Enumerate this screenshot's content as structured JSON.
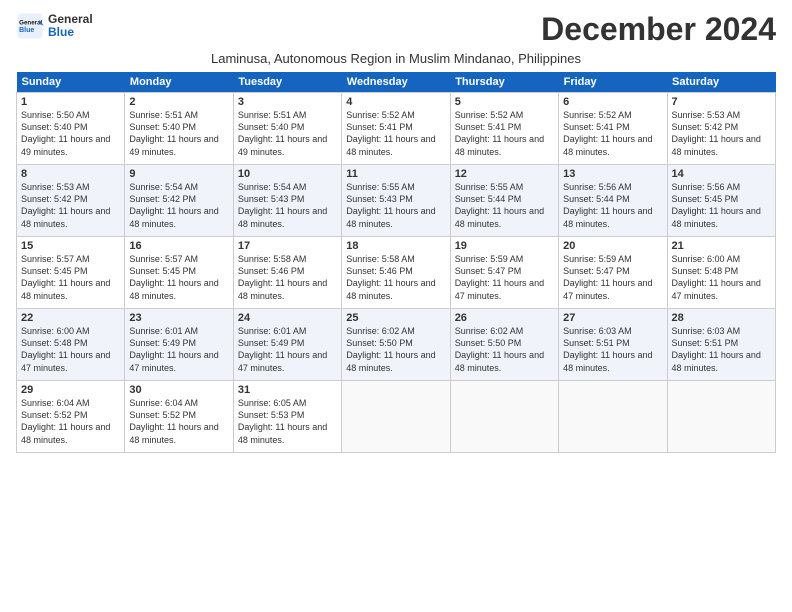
{
  "logo": {
    "line1": "General",
    "line2": "Blue"
  },
  "title": "December 2024",
  "subtitle": "Laminusa, Autonomous Region in Muslim Mindanao, Philippines",
  "days_header": [
    "Sunday",
    "Monday",
    "Tuesday",
    "Wednesday",
    "Thursday",
    "Friday",
    "Saturday"
  ],
  "weeks": [
    [
      {
        "day": "1",
        "sunrise": "5:50 AM",
        "sunset": "5:40 PM",
        "daylight": "11 hours and 49 minutes."
      },
      {
        "day": "2",
        "sunrise": "5:51 AM",
        "sunset": "5:40 PM",
        "daylight": "11 hours and 49 minutes."
      },
      {
        "day": "3",
        "sunrise": "5:51 AM",
        "sunset": "5:40 PM",
        "daylight": "11 hours and 49 minutes."
      },
      {
        "day": "4",
        "sunrise": "5:52 AM",
        "sunset": "5:41 PM",
        "daylight": "11 hours and 48 minutes."
      },
      {
        "day": "5",
        "sunrise": "5:52 AM",
        "sunset": "5:41 PM",
        "daylight": "11 hours and 48 minutes."
      },
      {
        "day": "6",
        "sunrise": "5:52 AM",
        "sunset": "5:41 PM",
        "daylight": "11 hours and 48 minutes."
      },
      {
        "day": "7",
        "sunrise": "5:53 AM",
        "sunset": "5:42 PM",
        "daylight": "11 hours and 48 minutes."
      }
    ],
    [
      {
        "day": "8",
        "sunrise": "5:53 AM",
        "sunset": "5:42 PM",
        "daylight": "11 hours and 48 minutes."
      },
      {
        "day": "9",
        "sunrise": "5:54 AM",
        "sunset": "5:42 PM",
        "daylight": "11 hours and 48 minutes."
      },
      {
        "day": "10",
        "sunrise": "5:54 AM",
        "sunset": "5:43 PM",
        "daylight": "11 hours and 48 minutes."
      },
      {
        "day": "11",
        "sunrise": "5:55 AM",
        "sunset": "5:43 PM",
        "daylight": "11 hours and 48 minutes."
      },
      {
        "day": "12",
        "sunrise": "5:55 AM",
        "sunset": "5:44 PM",
        "daylight": "11 hours and 48 minutes."
      },
      {
        "day": "13",
        "sunrise": "5:56 AM",
        "sunset": "5:44 PM",
        "daylight": "11 hours and 48 minutes."
      },
      {
        "day": "14",
        "sunrise": "5:56 AM",
        "sunset": "5:45 PM",
        "daylight": "11 hours and 48 minutes."
      }
    ],
    [
      {
        "day": "15",
        "sunrise": "5:57 AM",
        "sunset": "5:45 PM",
        "daylight": "11 hours and 48 minutes."
      },
      {
        "day": "16",
        "sunrise": "5:57 AM",
        "sunset": "5:45 PM",
        "daylight": "11 hours and 48 minutes."
      },
      {
        "day": "17",
        "sunrise": "5:58 AM",
        "sunset": "5:46 PM",
        "daylight": "11 hours and 48 minutes."
      },
      {
        "day": "18",
        "sunrise": "5:58 AM",
        "sunset": "5:46 PM",
        "daylight": "11 hours and 48 minutes."
      },
      {
        "day": "19",
        "sunrise": "5:59 AM",
        "sunset": "5:47 PM",
        "daylight": "11 hours and 47 minutes."
      },
      {
        "day": "20",
        "sunrise": "5:59 AM",
        "sunset": "5:47 PM",
        "daylight": "11 hours and 47 minutes."
      },
      {
        "day": "21",
        "sunrise": "6:00 AM",
        "sunset": "5:48 PM",
        "daylight": "11 hours and 47 minutes."
      }
    ],
    [
      {
        "day": "22",
        "sunrise": "6:00 AM",
        "sunset": "5:48 PM",
        "daylight": "11 hours and 47 minutes."
      },
      {
        "day": "23",
        "sunrise": "6:01 AM",
        "sunset": "5:49 PM",
        "daylight": "11 hours and 47 minutes."
      },
      {
        "day": "24",
        "sunrise": "6:01 AM",
        "sunset": "5:49 PM",
        "daylight": "11 hours and 47 minutes."
      },
      {
        "day": "25",
        "sunrise": "6:02 AM",
        "sunset": "5:50 PM",
        "daylight": "11 hours and 48 minutes."
      },
      {
        "day": "26",
        "sunrise": "6:02 AM",
        "sunset": "5:50 PM",
        "daylight": "11 hours and 48 minutes."
      },
      {
        "day": "27",
        "sunrise": "6:03 AM",
        "sunset": "5:51 PM",
        "daylight": "11 hours and 48 minutes."
      },
      {
        "day": "28",
        "sunrise": "6:03 AM",
        "sunset": "5:51 PM",
        "daylight": "11 hours and 48 minutes."
      }
    ],
    [
      {
        "day": "29",
        "sunrise": "6:04 AM",
        "sunset": "5:52 PM",
        "daylight": "11 hours and 48 minutes."
      },
      {
        "day": "30",
        "sunrise": "6:04 AM",
        "sunset": "5:52 PM",
        "daylight": "11 hours and 48 minutes."
      },
      {
        "day": "31",
        "sunrise": "6:05 AM",
        "sunset": "5:53 PM",
        "daylight": "11 hours and 48 minutes."
      },
      null,
      null,
      null,
      null
    ]
  ]
}
